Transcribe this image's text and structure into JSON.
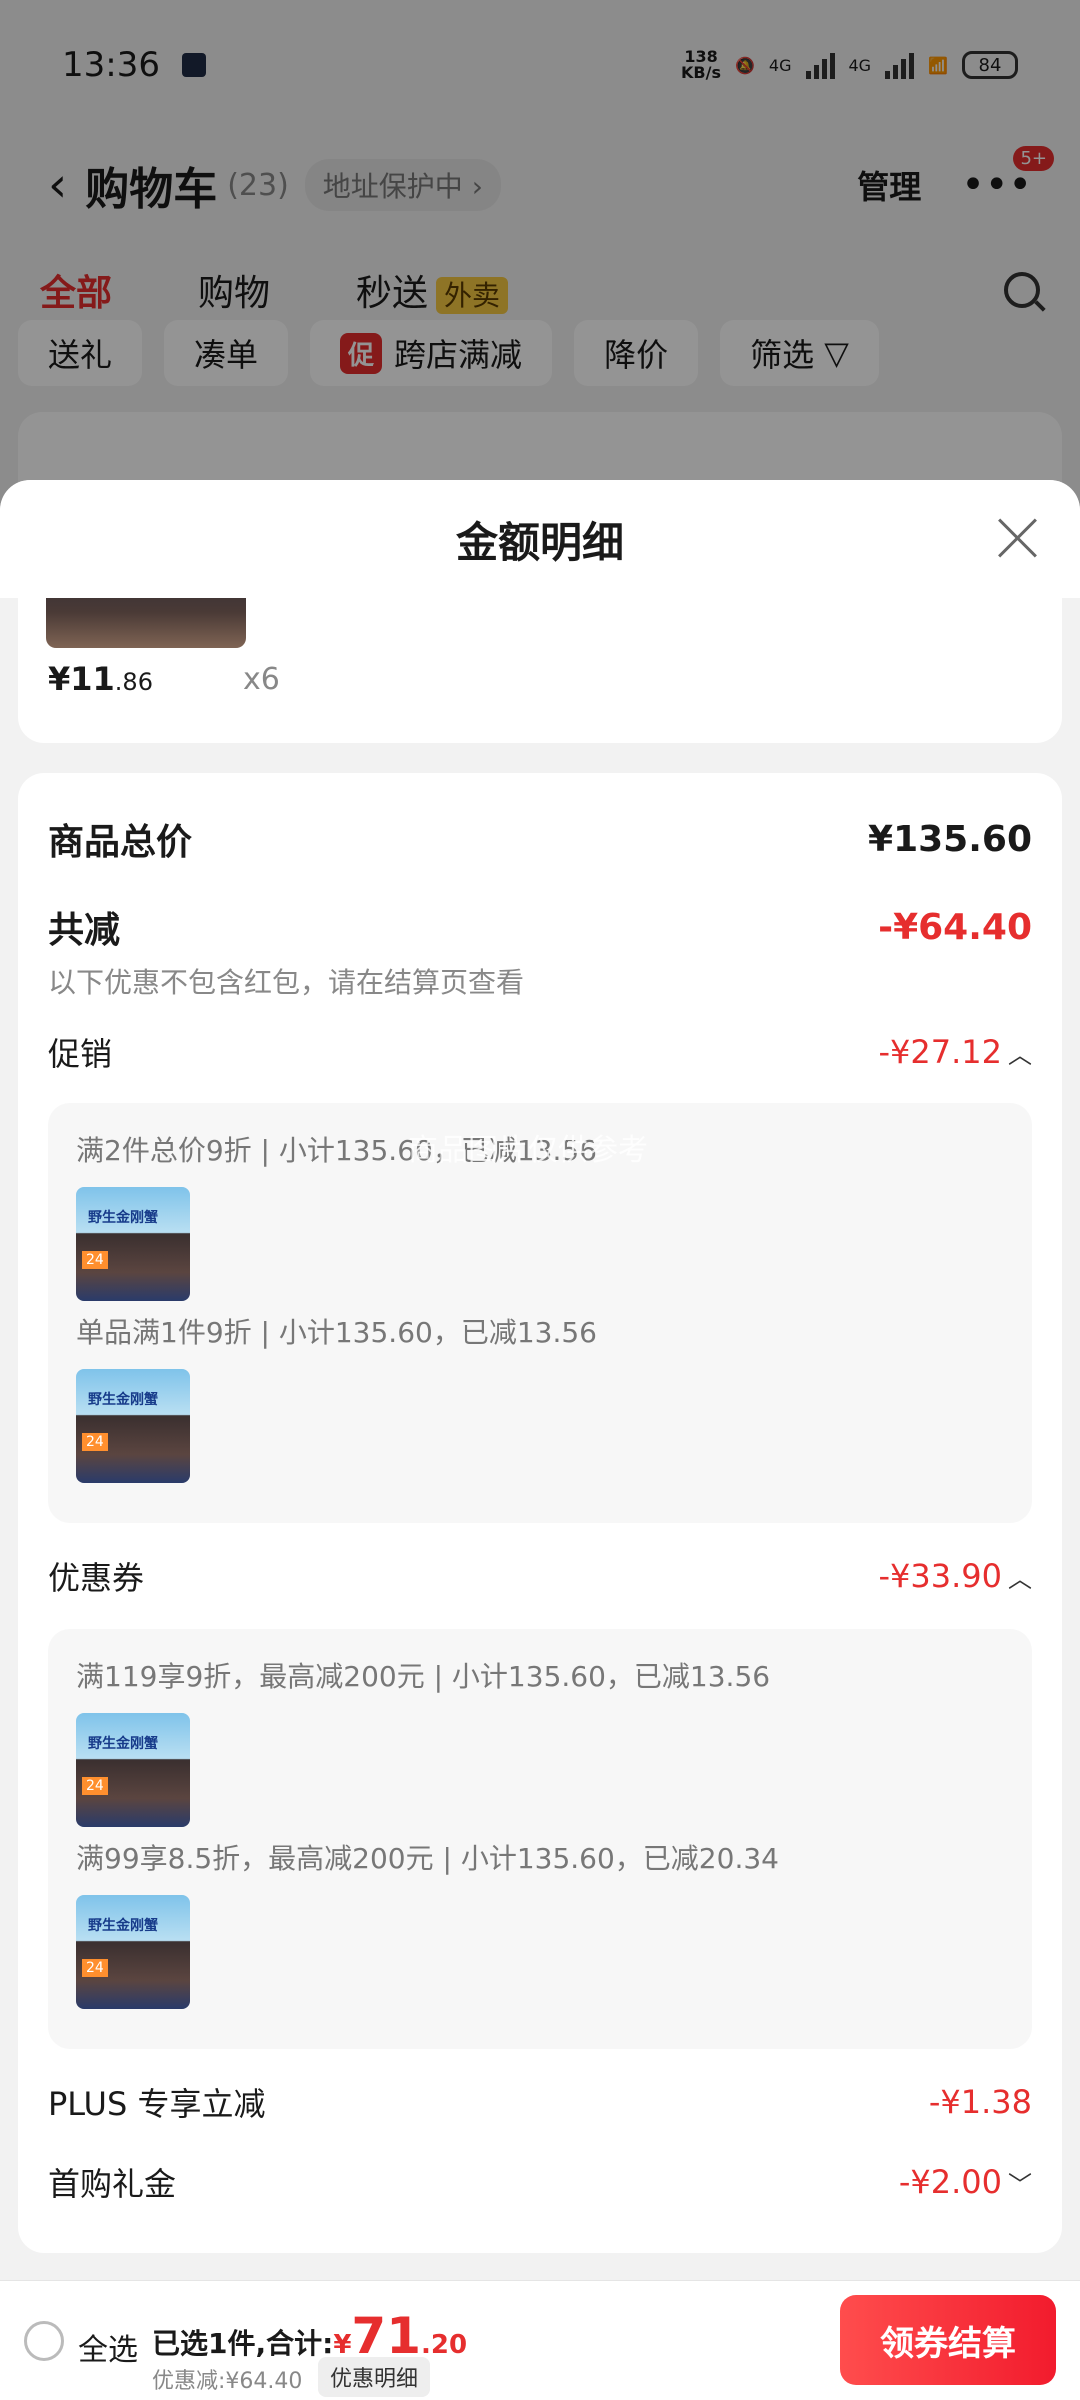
{
  "status_bar": {
    "time": "13:36",
    "net_speed_top": "138",
    "net_speed_bottom": "KB/s",
    "net_4g_1": "4G",
    "net_4g_2": "4G",
    "battery": "84"
  },
  "header": {
    "title": "购物车",
    "count": "(23)",
    "address_pill": "地址保护中 ›",
    "manage": "管理",
    "more_badge": "5+"
  },
  "tabs": [
    {
      "label": "全部"
    },
    {
      "label": "购物"
    },
    {
      "label": "秒送"
    }
  ],
  "takeout_tag": "外卖",
  "filters": {
    "gift": "送礼",
    "bundle": "凑单",
    "promo_tag": "促",
    "cross_store": "跨店满减",
    "price_drop": "降价",
    "filter": "筛选"
  },
  "sheet": {
    "title": "金额明细",
    "item": {
      "price_int": "¥11",
      "price_dec": ".86",
      "qty": "x6"
    },
    "total_label": "商品总价",
    "total_value": "¥135.60",
    "reduce_label": "共减",
    "reduce_value": "-¥64.40",
    "reduce_note": "以下优惠不包含红包，请在结算页查看",
    "promo": {
      "label": "促销",
      "value": "-¥27.12",
      "line1": "满2件总价9折 | 小计135.60，已减13.56",
      "watermark": "商品图片仅供参考",
      "line2": "单品满1件9折 | 小计135.60，已减13.56"
    },
    "coupon": {
      "label": "优惠券",
      "value": "-¥33.90",
      "line1": "满119享9折，最高减200元 | 小计135.60，已减13.56",
      "line2": "满99享8.5折，最高减200元 | 小计135.60，已减20.34"
    },
    "plus": {
      "label": "PLUS 专享立减",
      "value": "-¥1.38"
    },
    "first": {
      "label": "首购礼金",
      "value": "-¥2.00"
    },
    "product_name": "野生金刚蟹"
  },
  "bottom": {
    "select_all": "全选",
    "selected": "已选1件,合计:",
    "currency": "¥",
    "total_int": "71",
    "total_dec": ".20",
    "discount": "优惠减:¥64.40",
    "detail_btn": "优惠明细",
    "checkout": "领券结算"
  },
  "colors": {
    "accent_red": "#e62e2e",
    "takeout_yellow": "#f4c843"
  }
}
